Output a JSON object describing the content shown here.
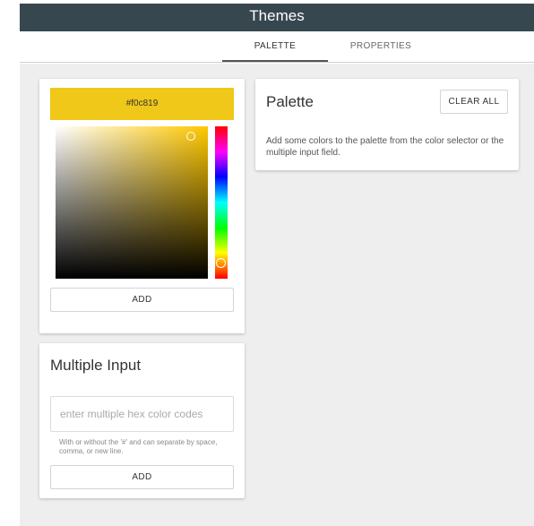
{
  "header": {
    "title": "Themes"
  },
  "tabs": [
    {
      "label": "PALETTE",
      "active": true
    },
    {
      "label": "PROPERTIES",
      "active": false
    }
  ],
  "picker": {
    "hex": "#f0c819",
    "color": "#f0c819",
    "hue_color": "#ffc800",
    "add_label": "ADD"
  },
  "multiple_input": {
    "title": "Multiple Input",
    "value": "",
    "placeholder": "enter multiple hex color codes",
    "help": "With or without the '#' and can separate by space, comma, or new line.",
    "add_label": "ADD"
  },
  "palette": {
    "title": "Palette",
    "clear_label": "CLEAR ALL",
    "empty_message": "Add some colors to the palette from the color selector or the multiple input field."
  },
  "colors": {
    "header_bg": "#37474f",
    "content_bg": "#eeeeee",
    "accent": "#f0c819"
  }
}
